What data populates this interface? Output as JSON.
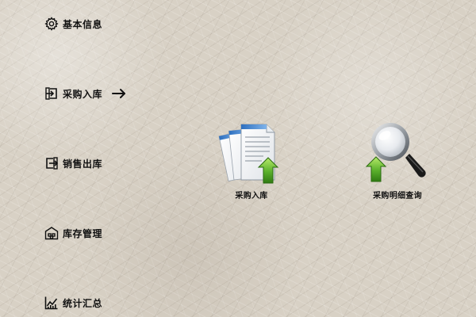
{
  "sidebar": {
    "items": [
      {
        "label": "基本信息",
        "icon": "gear-icon"
      },
      {
        "label": "采购入库",
        "icon": "sign-in-icon",
        "active": true,
        "indicator": "arrow-right-icon"
      },
      {
        "label": "销售出库",
        "icon": "sign-out-icon"
      },
      {
        "label": "库存管理",
        "icon": "warehouse-icon"
      },
      {
        "label": "统计汇总",
        "icon": "line-chart-icon"
      }
    ]
  },
  "main": {
    "tiles": [
      {
        "label": "采购入库",
        "icon": "documents-upload-icon"
      },
      {
        "label": "采购明细查询",
        "icon": "magnifier-upload-icon"
      }
    ]
  },
  "colors": {
    "background": "#d8d1c5",
    "text": "#111111",
    "upload_arrow": "#5bb12c",
    "doc_header": "#3d83d0"
  }
}
